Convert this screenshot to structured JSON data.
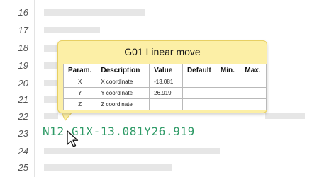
{
  "editor": {
    "line_numbers": [
      "16",
      "17",
      "18",
      "19",
      "20",
      "21",
      "22",
      "23",
      "24",
      "25"
    ],
    "code_line": "N12 G1X-13.081Y26.919",
    "code_color": "#2e9a66"
  },
  "tooltip": {
    "title": "G01 Linear move",
    "background": "#fcefa6",
    "headers": [
      "Param.",
      "Description",
      "Value",
      "Default",
      "Min.",
      "Max."
    ],
    "rows": [
      {
        "param": "X",
        "description": "X coordinate",
        "value": "-13.081",
        "default": "",
        "min": "",
        "max": ""
      },
      {
        "param": "Y",
        "description": "Y coordinate",
        "value": "26.919",
        "default": "",
        "min": "",
        "max": ""
      },
      {
        "param": "Z",
        "description": "Z coordinate",
        "value": "",
        "default": "",
        "min": "",
        "max": ""
      }
    ]
  },
  "icons": {
    "cursor": "mouse-pointer-icon"
  }
}
